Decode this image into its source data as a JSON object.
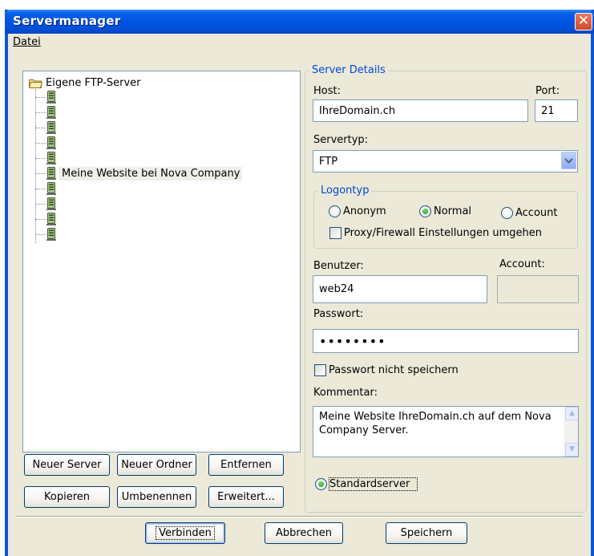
{
  "window": {
    "title": "Servermanager"
  },
  "menu": {
    "file_label": "Datei"
  },
  "tree": {
    "root_label": "Eigene FTP-Server",
    "nodes": [
      "",
      "",
      "",
      "",
      "",
      "Meine Website bei Nova Company",
      "",
      "",
      "",
      ""
    ]
  },
  "left_buttons": {
    "new_server": "Neuer Server",
    "new_folder": "Neuer Ordner",
    "remove": "Entfernen",
    "copy": "Kopieren",
    "rename": "Umbenennen",
    "advanced": "Erweitert..."
  },
  "details": {
    "group_title": "Server Details",
    "host_label": "Host:",
    "host_value": "IhreDomain.ch",
    "port_label": "Port:",
    "port_value": "21",
    "servertype_label": "Servertyp:",
    "servertype_value": "FTP",
    "logon_group_title": "Logontyp",
    "logon_options": [
      "Anonym",
      "Normal",
      "Account"
    ],
    "logon_selected": "Normal",
    "proxy_label": "Proxy/Firewall Einstellungen umgehen",
    "user_label": "Benutzer:",
    "user_value": "web24",
    "account_label": "Account:",
    "account_value": "",
    "password_label": "Passwort:",
    "password_value": "••••••••",
    "no_save_password_label": "Passwort nicht speichern",
    "comment_label": "Kommentar:",
    "comment_value": "Meine Website IhreDomain.ch auf dem Nova Company Server.",
    "default_server_label": "Standardserver"
  },
  "footer_buttons": {
    "connect": "Verbinden",
    "cancel": "Abbrechen",
    "save": "Speichern"
  },
  "colors": {
    "titlebar": "#0054E3",
    "dialog_bg": "#ECE9D8",
    "groupbox_title": "#0046D5",
    "input_border": "#7F9DB9"
  }
}
